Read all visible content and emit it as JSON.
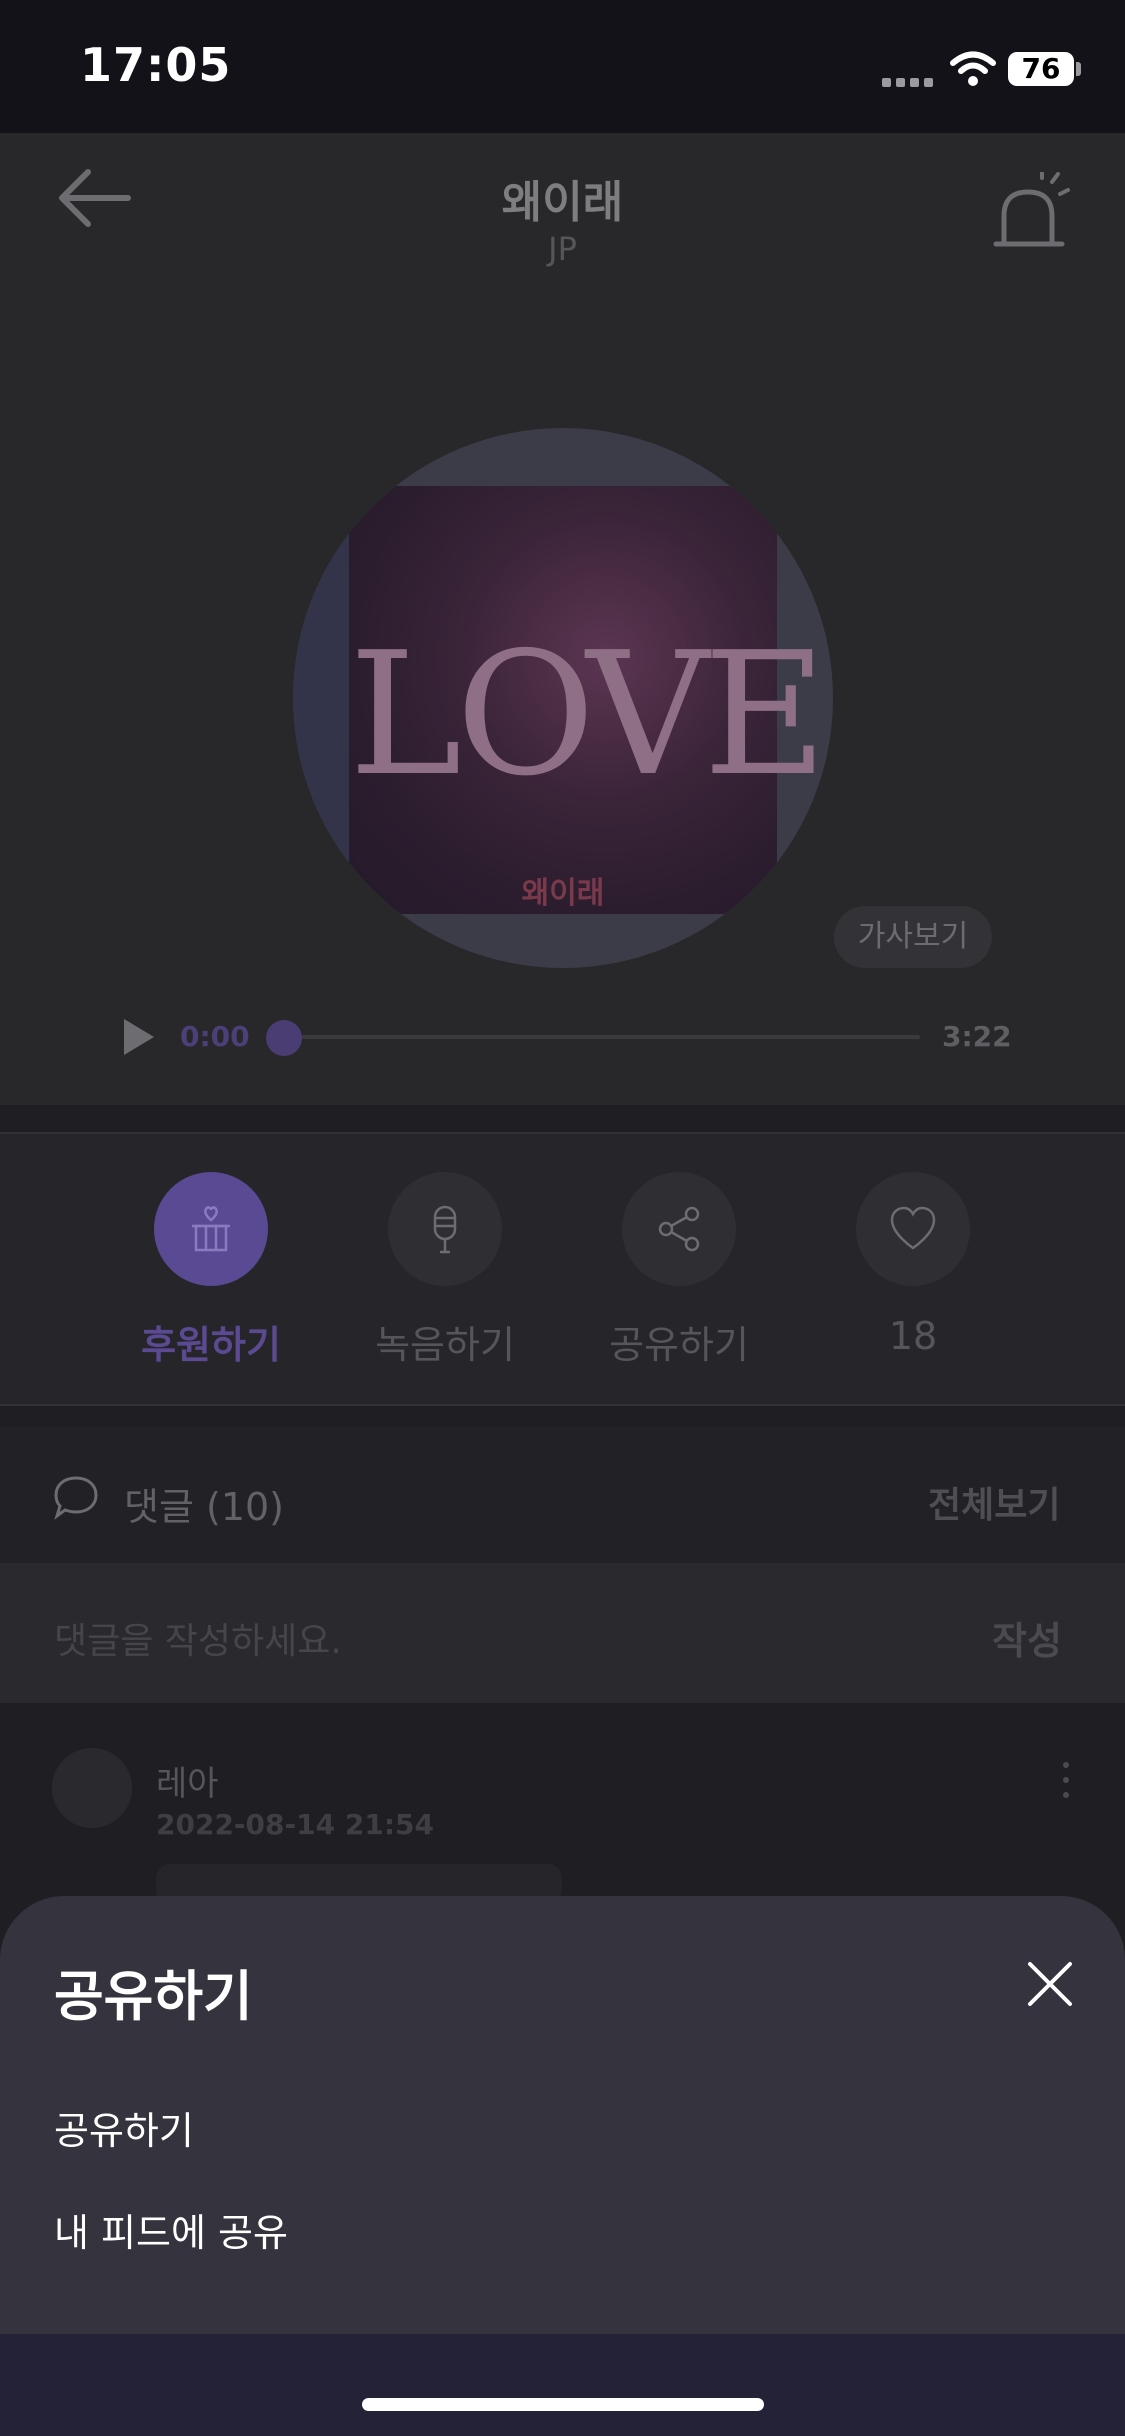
{
  "status_bar": {
    "time": "17:05",
    "battery": "76"
  },
  "header": {
    "title": "왜이래",
    "artist": "JP"
  },
  "player": {
    "cover_text": "LOVE",
    "cover_label": "왜이래",
    "lyrics_button": "가사보기",
    "current_time": "0:00",
    "duration": "3:22",
    "progress": 0.0
  },
  "actions": [
    {
      "label": "후원하기",
      "icon": "gift-heart-icon"
    },
    {
      "label": "녹음하기",
      "icon": "microphone-icon"
    },
    {
      "label": "공유하기",
      "icon": "share-icon"
    },
    {
      "label": "18",
      "icon": "heart-icon"
    }
  ],
  "comments": {
    "title": "댓글 (10)",
    "view_all": "전체보기",
    "input_placeholder": "댓글을 작성하세요.",
    "submit": "작성",
    "items": [
      {
        "user": "레아",
        "date": "2022-08-14 21:54"
      }
    ]
  },
  "share_sheet": {
    "title": "공유하기",
    "options": [
      "공유하기",
      "내 피드에 공유"
    ]
  },
  "colors": {
    "accent": "#5a4a93",
    "sheet": "#34333e",
    "background": "#1f1f23"
  }
}
